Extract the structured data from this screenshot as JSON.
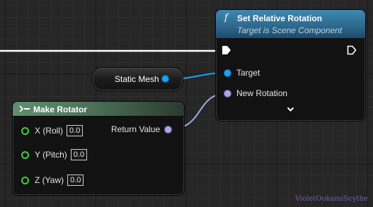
{
  "set_node": {
    "title": "Set Relative Rotation",
    "subtitle": "Target is Scene Component",
    "func_glyph": "f",
    "pins": {
      "target": "Target",
      "new_rotation": "New Rotation"
    },
    "expand_glyph": "⌄"
  },
  "mesh_node": {
    "label": "Static Mesh"
  },
  "rotator_node": {
    "title": "Make Rotator",
    "inputs": [
      {
        "label": "X (Roll)",
        "value": "0.0"
      },
      {
        "label": "Y (Pitch)",
        "value": "0.0"
      },
      {
        "label": "Z (Yaw)",
        "value": "0.0"
      }
    ],
    "output": "Return Value"
  },
  "watermark": "VioletOokamiScythe",
  "colors": {
    "exec_wire": "#ffffff",
    "object_pin": "#19a3f2",
    "rotator_pin": "#a7a8e8",
    "float_pin": "#3fd13f",
    "function_header": "#3f88b2",
    "pure_header": "#5f8f6f"
  }
}
